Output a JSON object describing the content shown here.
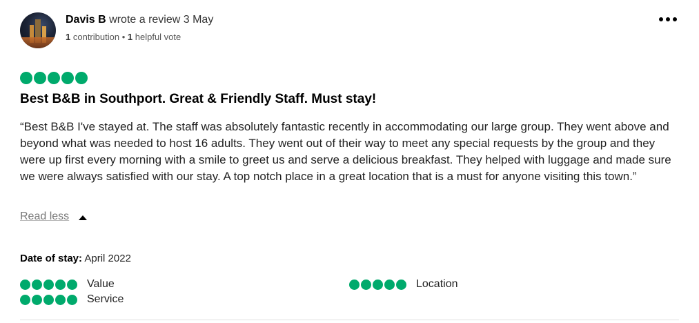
{
  "reviewer": {
    "name": "Davis B",
    "action": "wrote a review 3 May",
    "contributions_count": "1",
    "contributions_label": "contribution",
    "separator": "•",
    "helpful_count": "1",
    "helpful_label": "helpful vote"
  },
  "review": {
    "rating": 5,
    "title": "Best B&B in Southport. Great & Friendly Staff. Must stay!",
    "text": "“Best B&B I've stayed at. The staff was absolutely fantastic recently in accommodating our large group. They went above and beyond what was needed to host 16 adults. They went out of their way to meet any special requests by the group and they were up first every morning with a smile to greet us and serve a delicious breakfast. They helped with luggage and made sure we were always satisfied with our stay. A top notch place in a great location that is a must for anyone visiting this town.”",
    "read_less_label": "Read less",
    "date_of_stay_label": "Date of stay:",
    "date_of_stay_value": "April 2022"
  },
  "sub_ratings": [
    {
      "label": "Value",
      "rating": 5
    },
    {
      "label": "Location",
      "rating": 5
    },
    {
      "label": "Service",
      "rating": 5
    }
  ],
  "colors": {
    "bubble": "#00aa6c"
  },
  "icons": {
    "more": "more-options-icon",
    "caret": "caret-up-icon"
  }
}
